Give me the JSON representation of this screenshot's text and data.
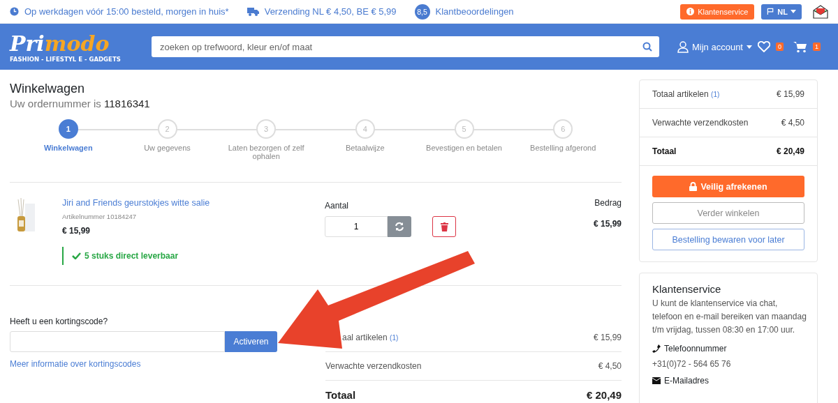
{
  "topbar": {
    "usps": [
      {
        "kind": "clock",
        "text": "Op werkdagen vóór 15:00 besteld, morgen in huis*"
      },
      {
        "kind": "truck",
        "text": "Verzending NL € 4,50, BE € 5,99"
      },
      {
        "kind": "rating",
        "badge": "8,5",
        "text": "Klantbeoordelingen"
      }
    ],
    "service_button": "Klantenservice",
    "language": "NL"
  },
  "header": {
    "logo": {
      "brand_a": "Pri",
      "brand_b": "modo",
      "tagline": "FASHION - LIFESTYL E - GADGETS"
    },
    "search": {
      "placeholder": "zoeken op trefwoord, kleur en/of maat"
    },
    "account": "Mijn account",
    "wishlist_count": "0",
    "cart_count": "1"
  },
  "page": {
    "title": "Winkelwagen",
    "order_label": "Uw ordernummer is",
    "order_number": "11816341"
  },
  "steps": [
    {
      "number": "1",
      "label": "Winkelwagen",
      "selected": true
    },
    {
      "number": "2",
      "label": "Uw gegevens",
      "selected": false
    },
    {
      "number": "3",
      "label": "Laten bezorgen of zelf ophalen",
      "selected": false
    },
    {
      "number": "4",
      "label": "Betaalwijze",
      "selected": false
    },
    {
      "number": "5",
      "label": "Bevestigen en betalen",
      "selected": false
    },
    {
      "number": "6",
      "label": "Bestelling afgerond",
      "selected": false
    }
  ],
  "cart_item": {
    "name": "Jiri and Friends geurstokjes witte salie",
    "article": "Artikelnummer 10184247",
    "price": "€ 15,99",
    "stock": "5 stuks direct leverbaar",
    "quantity_label": "Aantal",
    "quantity": "1",
    "amount_label": "Bedrag",
    "amount": "€ 15,99"
  },
  "discount": {
    "label": "Heeft u een kortingscode?",
    "button": "Activeren",
    "link": "Meer informatie over kortingscodes"
  },
  "bottom_totals": [
    {
      "kind": "normal",
      "label": "aal artikelen",
      "count": "(1)",
      "value": "€ 15,99"
    },
    {
      "kind": "normal",
      "label": "Verwachte verzendkosten",
      "value": "€ 4,50"
    },
    {
      "kind": "total",
      "label": "Totaal",
      "value": "€ 20,49"
    }
  ],
  "summary": {
    "rows": [
      {
        "kind": "normal",
        "label": "Totaal artikelen",
        "count": "(1)",
        "value": "€ 15,99"
      },
      {
        "kind": "normal",
        "label": "Verwachte verzendkosten",
        "value": "€ 4,50"
      },
      {
        "kind": "total",
        "label": "Totaal",
        "value": "€ 20,49"
      }
    ],
    "checkout_button": "Veilig afrekenen",
    "continue_button": "Verder winkelen",
    "save_button": "Bestelling bewaren voor later"
  },
  "service": {
    "title": "Klantenservice",
    "text": "U kunt de klantenservice via chat, telefoon en e-mail bereiken van maandag t/m vrijdag, tussen 08:30 en 17:00 uur.",
    "phone_label": "Telefoonnummer",
    "phone": "+31(0)72 - 564 65 76",
    "email_label": "E-Mailadres"
  }
}
